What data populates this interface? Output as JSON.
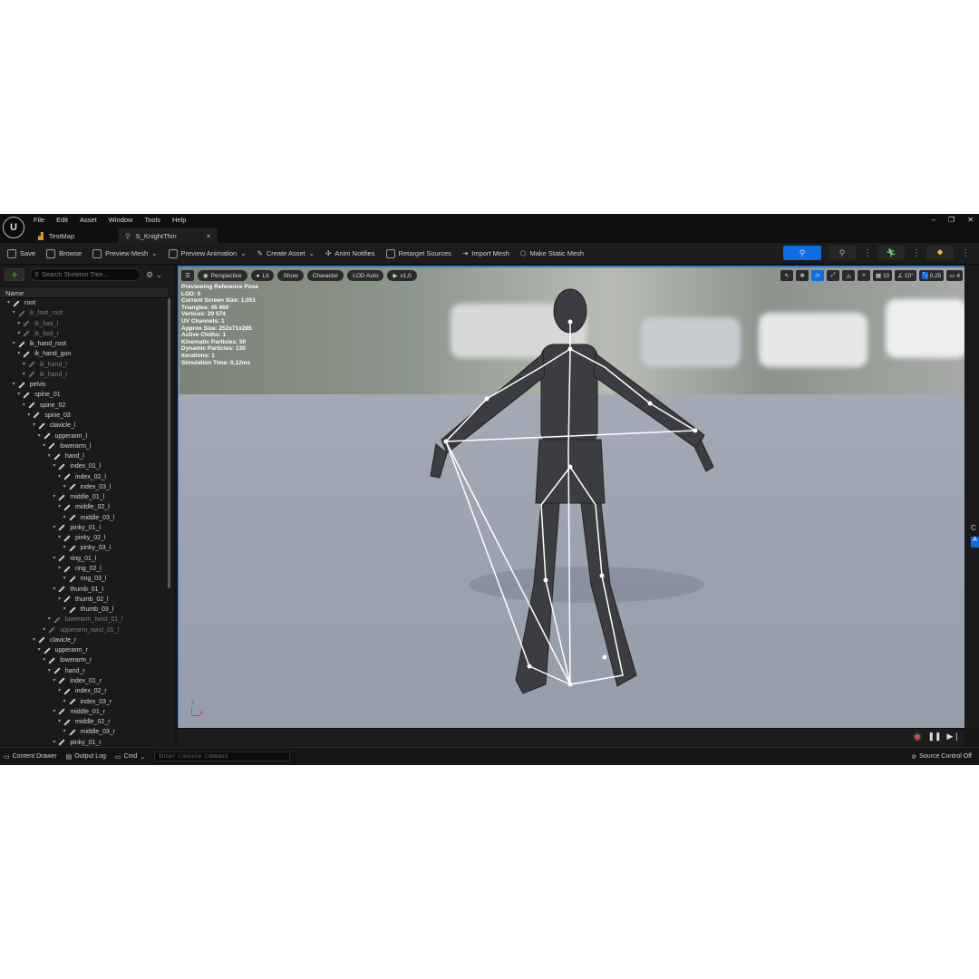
{
  "menu": [
    "File",
    "Edit",
    "Asset",
    "Window",
    "Tools",
    "Help"
  ],
  "window_controls": {
    "minimize": "–",
    "restore": "❐",
    "close": "✕"
  },
  "tabs": [
    {
      "label": "TestMap"
    },
    {
      "label": "S_KnightThin",
      "close": "×"
    }
  ],
  "toolbar": {
    "save": "Save",
    "browse": "Browse",
    "preview_mesh": "Preview Mesh",
    "preview_animation": "Preview Animation",
    "create_asset": "Create Asset",
    "anim_notifies": "Anim Notifies",
    "retarget_sources": "Retarget Sources",
    "import_mesh": "Import Mesh",
    "make_static_mesh": "Make Static Mesh"
  },
  "skeleton_tree": {
    "search_placeholder": "Search Skeleton Tree...",
    "column_name": "Name",
    "bones": [
      {
        "name": "root",
        "depth": 0,
        "dim": false
      },
      {
        "name": "ik_foot_root",
        "depth": 1,
        "dim": true
      },
      {
        "name": "ik_foot_l",
        "depth": 2,
        "dim": true
      },
      {
        "name": "ik_foot_r",
        "depth": 2,
        "dim": true
      },
      {
        "name": "ik_hand_root",
        "depth": 1,
        "dim": false
      },
      {
        "name": "ik_hand_gun",
        "depth": 2,
        "dim": false
      },
      {
        "name": "ik_hand_l",
        "depth": 3,
        "dim": true
      },
      {
        "name": "ik_hand_r",
        "depth": 3,
        "dim": true
      },
      {
        "name": "pelvis",
        "depth": 1,
        "dim": false
      },
      {
        "name": "spine_01",
        "depth": 2,
        "dim": false
      },
      {
        "name": "spine_02",
        "depth": 3,
        "dim": false
      },
      {
        "name": "spine_03",
        "depth": 4,
        "dim": false
      },
      {
        "name": "clavicle_l",
        "depth": 5,
        "dim": false
      },
      {
        "name": "upperarm_l",
        "depth": 6,
        "dim": false
      },
      {
        "name": "lowerarm_l",
        "depth": 7,
        "dim": false
      },
      {
        "name": "hand_l",
        "depth": 8,
        "dim": false
      },
      {
        "name": "index_01_l",
        "depth": 9,
        "dim": false
      },
      {
        "name": "index_02_l",
        "depth": 10,
        "dim": false
      },
      {
        "name": "index_03_l",
        "depth": 11,
        "dim": false
      },
      {
        "name": "middle_01_l",
        "depth": 9,
        "dim": false
      },
      {
        "name": "middle_02_l",
        "depth": 10,
        "dim": false
      },
      {
        "name": "middle_03_l",
        "depth": 11,
        "dim": false
      },
      {
        "name": "pinky_01_l",
        "depth": 9,
        "dim": false
      },
      {
        "name": "pinky_02_l",
        "depth": 10,
        "dim": false
      },
      {
        "name": "pinky_03_l",
        "depth": 11,
        "dim": false
      },
      {
        "name": "ring_01_l",
        "depth": 9,
        "dim": false
      },
      {
        "name": "ring_02_l",
        "depth": 10,
        "dim": false
      },
      {
        "name": "ring_03_l",
        "depth": 11,
        "dim": false
      },
      {
        "name": "thumb_01_l",
        "depth": 9,
        "dim": false
      },
      {
        "name": "thumb_02_l",
        "depth": 10,
        "dim": false
      },
      {
        "name": "thumb_03_l",
        "depth": 11,
        "dim": false
      },
      {
        "name": "lowerarm_twist_01_l",
        "depth": 8,
        "dim": true
      },
      {
        "name": "upperarm_twist_01_l",
        "depth": 7,
        "dim": true
      },
      {
        "name": "clavicle_r",
        "depth": 5,
        "dim": false
      },
      {
        "name": "upperarm_r",
        "depth": 6,
        "dim": false
      },
      {
        "name": "lowerarm_r",
        "depth": 7,
        "dim": false
      },
      {
        "name": "hand_r",
        "depth": 8,
        "dim": false
      },
      {
        "name": "index_01_r",
        "depth": 9,
        "dim": false
      },
      {
        "name": "index_02_r",
        "depth": 10,
        "dim": false
      },
      {
        "name": "index_03_r",
        "depth": 11,
        "dim": false
      },
      {
        "name": "middle_01_r",
        "depth": 9,
        "dim": false
      },
      {
        "name": "middle_02_r",
        "depth": 10,
        "dim": false
      },
      {
        "name": "middle_03_r",
        "depth": 11,
        "dim": false
      },
      {
        "name": "pinky_01_r",
        "depth": 9,
        "dim": false
      }
    ]
  },
  "viewport": {
    "perspective": "Perspective",
    "lit": "Lit",
    "show": "Show",
    "character": "Character",
    "lod": "LOD Auto",
    "speed": "x1,0",
    "grid_snap": "10",
    "rot_snap": "10°",
    "scale_snap": "0,25",
    "camera_speed": "4",
    "stats": [
      "Previewing Reference Pose",
      "LOD: 0",
      "Current Screen Size: 1,051",
      "Triangles: 45 960",
      "Vertices: 29 574",
      "UV Channels: 1",
      "Approx Size: 252x71x285",
      "Active Cloths: 1",
      "Kinematic Particles: 50",
      "Dynamic Particles: 130",
      "Iterations: 1",
      "Simulation Time: 0,12ms"
    ],
    "axis_z": "Z",
    "axis_x": "X"
  },
  "statusbar": {
    "content_drawer": "Content Drawer",
    "output_log": "Output Log",
    "cmd": "Cmd",
    "console_placeholder": "Enter Console Command",
    "source_control": "Source Control Off"
  },
  "colors": {
    "accent": "#0c6ee0",
    "add": "#5bbf3f",
    "record": "#d24a4a"
  }
}
